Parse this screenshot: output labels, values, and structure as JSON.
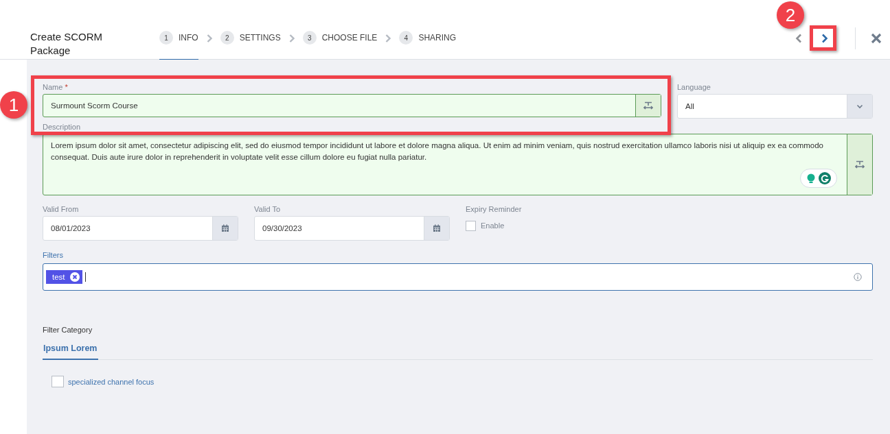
{
  "header": {
    "title": "Create SCORM Package"
  },
  "steps": [
    {
      "number": "1",
      "label": "INFO",
      "selected": true
    },
    {
      "number": "2",
      "label": "SETTINGS",
      "selected": false
    },
    {
      "number": "3",
      "label": "CHOOSE FILE",
      "selected": false
    },
    {
      "number": "4",
      "label": "SHARING",
      "selected": false
    }
  ],
  "callouts": [
    {
      "label": "1"
    },
    {
      "label": "2"
    }
  ],
  "name": {
    "label": "Name",
    "required_mark": "*",
    "value": "Surmount Scorm Course"
  },
  "language": {
    "label": "Language",
    "value": "All"
  },
  "description": {
    "label": "Description",
    "value": "Lorem ipsum dolor sit amet, consectetur adipiscing elit, sed do eiusmod tempor incididunt ut labore et dolore magna aliqua. Ut enim ad minim veniam, quis nostrud exercitation ullamco laboris nisi ut aliquip ex ea commodo consequat. Duis aute irure dolor in reprehenderit in voluptate velit esse cillum dolore eu fugiat nulla pariatur."
  },
  "valid_from": {
    "label": "Valid From",
    "value": "08/01/2023"
  },
  "valid_to": {
    "label": "Valid To",
    "value": "09/30/2023"
  },
  "expiry_reminder": {
    "label": "Expiry Reminder",
    "option": "Enable",
    "checked": false
  },
  "filters": {
    "label": "Filters",
    "tags": [
      "test"
    ]
  },
  "filter_category": {
    "label": "Filter Category",
    "tabs": [
      {
        "label": "Ipsum Lorem",
        "selected": true
      }
    ],
    "options": [
      {
        "label": "specialized channel focus",
        "checked": false
      }
    ]
  }
}
